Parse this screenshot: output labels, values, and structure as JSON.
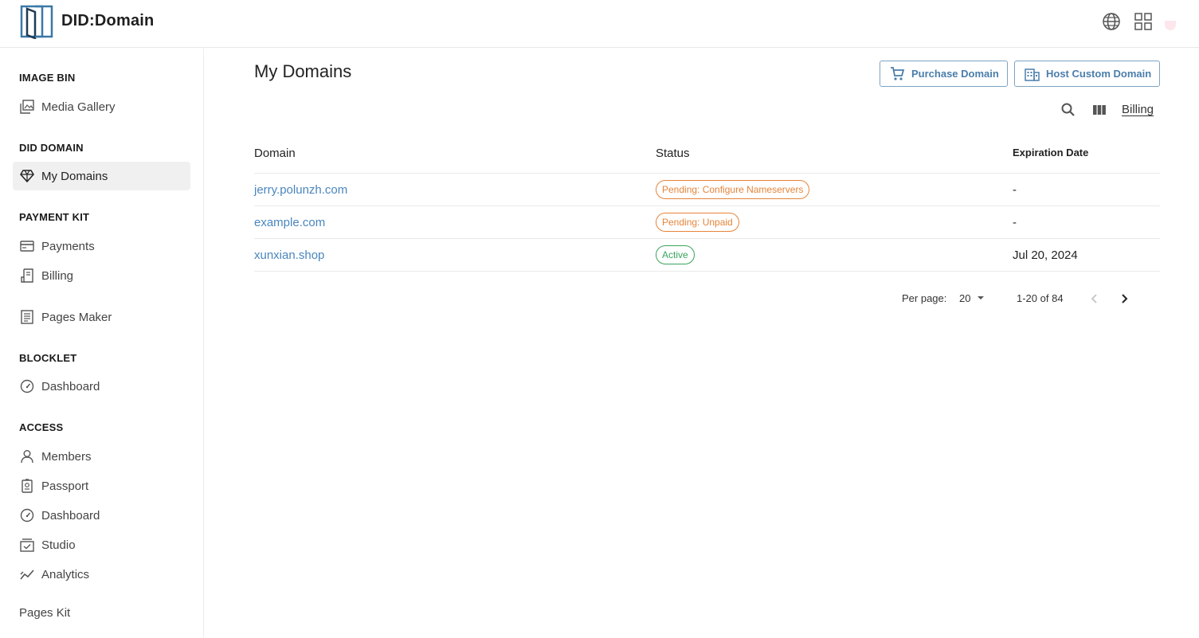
{
  "header": {
    "app_title": "DID:Domain",
    "icons": [
      "globe-icon",
      "apps-grid-icon",
      "avatar"
    ]
  },
  "sidebar": {
    "sections": [
      {
        "title": "IMAGE BIN",
        "items": [
          {
            "label": "Media Gallery",
            "icon": "image-gallery-icon"
          }
        ]
      },
      {
        "title": "DID DOMAIN",
        "items": [
          {
            "label": "My Domains",
            "icon": "diamond-icon",
            "active": true
          }
        ]
      },
      {
        "title": "PAYMENT KIT",
        "items": [
          {
            "label": "Payments",
            "icon": "credit-card-icon"
          },
          {
            "label": "Billing",
            "icon": "receipt-icon"
          }
        ]
      },
      {
        "title": "",
        "items": [
          {
            "label": "Pages Maker",
            "icon": "document-icon"
          }
        ]
      },
      {
        "title": "BLOCKLET",
        "items": [
          {
            "label": "Dashboard",
            "icon": "gauge-icon"
          }
        ]
      },
      {
        "title": "ACCESS",
        "items": [
          {
            "label": "Members",
            "icon": "person-icon"
          },
          {
            "label": "Passport",
            "icon": "passport-icon"
          },
          {
            "label": "Dashboard",
            "icon": "gauge-icon"
          },
          {
            "label": "Studio",
            "icon": "studio-icon"
          },
          {
            "label": "Analytics",
            "icon": "analytics-icon"
          }
        ]
      }
    ],
    "footer_item": "Pages Kit"
  },
  "main": {
    "title": "My Domains",
    "purchase_label": "Purchase Domain",
    "host_label": "Host Custom Domain",
    "billing_link": "Billing",
    "columns": {
      "domain": "Domain",
      "status": "Status",
      "expiration": "Expiration Date"
    },
    "rows": [
      {
        "domain": "jerry.polunzh.com",
        "status": "Pending: Configure Nameservers",
        "status_type": "warning",
        "expiration": "-"
      },
      {
        "domain": "example.com",
        "status": "Pending: Unpaid",
        "status_type": "warning",
        "expiration": "-"
      },
      {
        "domain": "xunxian.shop",
        "status": "Active",
        "status_type": "success",
        "expiration": "Jul 20, 2024"
      }
    ],
    "pagination": {
      "per_page_label": "Per page:",
      "per_page": "20",
      "range": "1-20 of 84"
    }
  },
  "colors": {
    "accent": "#4a86bd",
    "warning": "#e6843a",
    "success": "#3aa35c",
    "button_border": "#7ea3c4"
  }
}
